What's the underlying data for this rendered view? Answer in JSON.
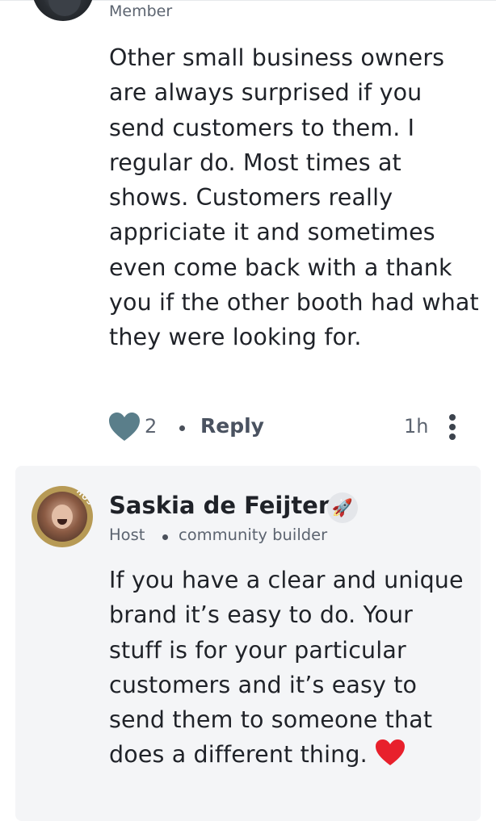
{
  "comment1": {
    "author_role": "Member",
    "body": "Other small business owners are always surprised if you send customers to them. I regular do. Most times at shows. Customers really appriciate it and sometimes even come back with a thank you if the other booth had what they were looking for.",
    "like_count": "2",
    "reply_label": "Reply",
    "time": "1h"
  },
  "comment2": {
    "author_name": "Saskia de Feijter",
    "avatar_badge": "HOST",
    "badge_icon": "rocket-icon",
    "role": "Host",
    "subtitle": "community builder",
    "body": "If you have a clear and unique brand it’s easy to do. Your stuff is for your particular customers and it’s easy to send them to someone that does a different thing.",
    "emoji": "red-heart-emoji"
  },
  "colors": {
    "heart_icon": "#5a7e8a",
    "card_background": "#f4f5f7",
    "avatar_ring": "#b79a55",
    "text_primary": "#1f2228",
    "text_secondary": "#5c6470"
  }
}
